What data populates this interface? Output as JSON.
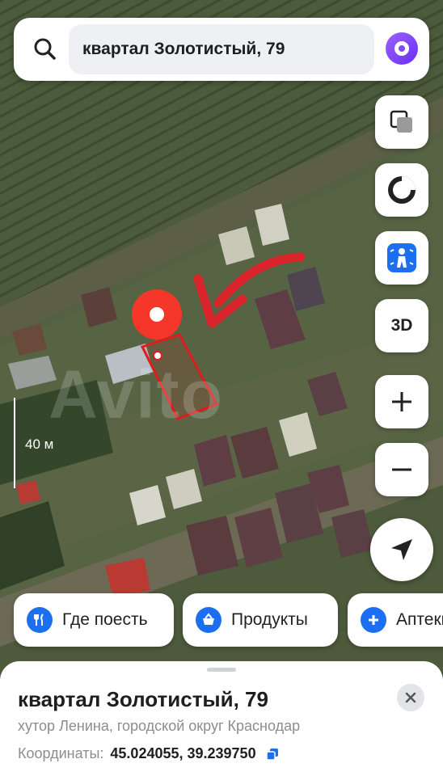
{
  "search": {
    "query": "квартал Золотистый, 79"
  },
  "map": {
    "scale_label": "40 м",
    "watermark": "Avito",
    "button_3d_label": "3D"
  },
  "chips": [
    {
      "label": "Где поесть",
      "icon": "fork-knife-icon"
    },
    {
      "label": "Продукты",
      "icon": "basket-icon"
    },
    {
      "label": "Аптеки",
      "icon": "plus-icon"
    }
  ],
  "place": {
    "title": "квартал Золотистый, 79",
    "subtitle": "хутор Ленина, городской округ Краснодар",
    "coords_label": "Координаты:",
    "coords_value": "45.024055, 39.239750"
  },
  "colors": {
    "pin": "#f5372a",
    "accent": "#1b6ff0",
    "parcel_outline": "#e01b1b",
    "arrow": "#d8242a"
  }
}
